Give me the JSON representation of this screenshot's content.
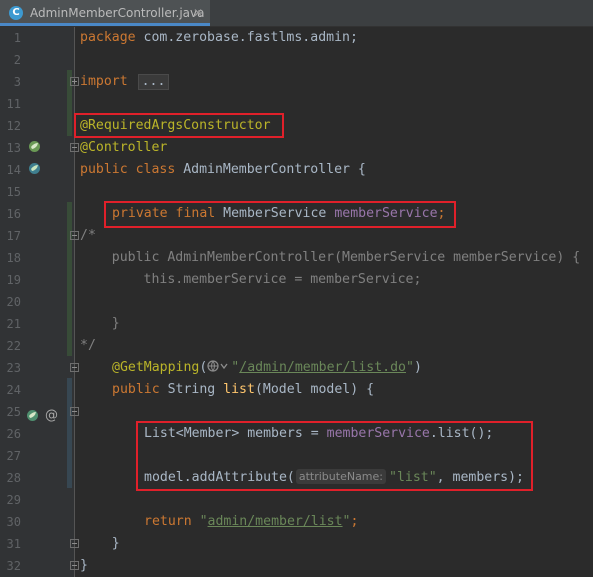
{
  "tab": {
    "title": "AdminMemberController.java",
    "icon_letter": "C",
    "close": "✕"
  },
  "gutter": {
    "line_numbers": [
      "1",
      "2",
      "3",
      "11",
      "12",
      "13",
      "14",
      "15",
      "16",
      "17",
      "18",
      "19",
      "20",
      "21",
      "22",
      "23",
      "24",
      "25",
      "26",
      "27",
      "28",
      "29",
      "30",
      "31",
      "32"
    ],
    "at_symbol": "@"
  },
  "code": {
    "l1_kw": "package",
    "l1_rest": " com.zerobase.fastlms.admin;",
    "l3_kw": "import",
    "l3_fold": "...",
    "l12_ann": "@RequiredArgsConstructor",
    "l13_ann": "@Controller",
    "l14_kw": "public class",
    "l14_rest": " AdminMemberController {",
    "l16_kw": "private final",
    "l16_type": " MemberService ",
    "l16_field": "memberService",
    "l16_end": ";",
    "l17": "/*",
    "l18": "    public AdminMemberController(MemberService memberService) {",
    "l19": "        this.memberService = memberService;",
    "l21": "    }",
    "l22": "*/",
    "l23_ann": "@GetMapping",
    "l23_open": "(",
    "l23_str_q1": "\"",
    "l23_path": "/admin/member/list.do",
    "l23_str_q2": "\"",
    "l23_close": ")",
    "l24_kw": "public",
    "l24_type": " String ",
    "l24_fn": "list",
    "l24_rest": "(Model model) {",
    "l26_a": "List<Member> members = ",
    "l26_field": "memberService",
    "l26_b": ".list();",
    "l28_a": "model.addAttribute(",
    "l28_hint": "attributeName:",
    "l28_str": "\"list\"",
    "l28_b": ", members);",
    "l30_kw": "return",
    "l30_sp": " ",
    "l30_q1": "\"",
    "l30_path": "admin/member/list",
    "l30_q2": "\"",
    "l30_end": ";",
    "l31": "    }",
    "l32": "}"
  },
  "colors": {
    "background": "#2b2b2b",
    "keyword": "#cc7832",
    "annotation": "#bbb529",
    "field": "#9876aa",
    "string": "#6a8759",
    "method": "#ffc66d",
    "highlight_box": "#e0202a"
  }
}
